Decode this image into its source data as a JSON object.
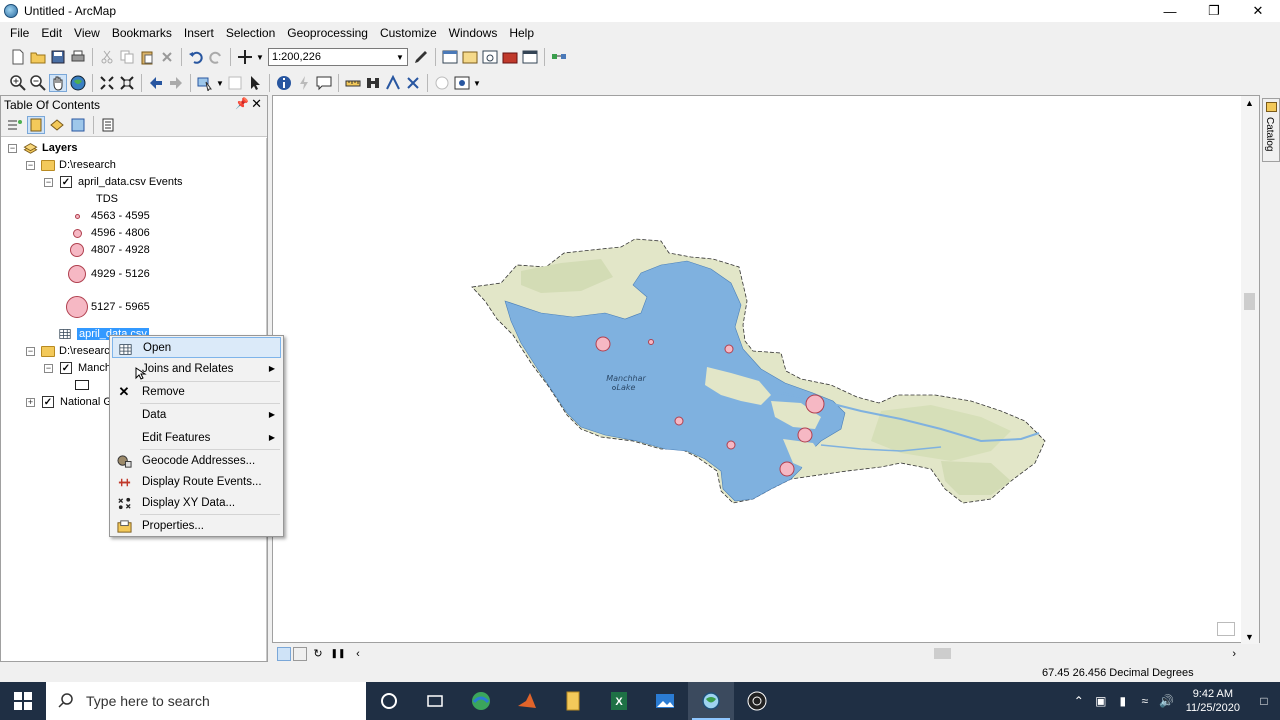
{
  "window": {
    "title": "Untitled - ArcMap"
  },
  "menu": [
    "File",
    "Edit",
    "View",
    "Bookmarks",
    "Insert",
    "Selection",
    "Geoprocessing",
    "Customize",
    "Windows",
    "Help"
  ],
  "toolbar": {
    "scale": "1:200,226"
  },
  "toc": {
    "title": "Table Of Contents",
    "root": "Layers",
    "group1": "D:\\research",
    "events_layer": "april_data.csv Events",
    "field": "TDS",
    "classes": [
      "4563 - 4595",
      "4596 - 4806",
      "4807 - 4928",
      "4929 - 5126",
      "5127 - 5965"
    ],
    "table": "april_data.csv",
    "group2": "D:\\research",
    "layer_manchhar": "Manchhar",
    "layer_basemap": "National Geographic"
  },
  "map": {
    "lake_label": "Manchhar Lake"
  },
  "context_menu": {
    "items": [
      {
        "label": "Open",
        "icon": "table-icon"
      },
      {
        "label": "Joins and Relates",
        "icon": "",
        "submenu": true
      },
      {
        "label": "Remove",
        "icon": "remove-icon"
      },
      {
        "label": "Data",
        "icon": "",
        "submenu": true
      },
      {
        "label": "Edit Features",
        "icon": "",
        "submenu": true
      },
      {
        "label": "Geocode Addresses...",
        "icon": "geocode-icon"
      },
      {
        "label": "Display Route Events...",
        "icon": "route-events-icon"
      },
      {
        "label": "Display XY Data...",
        "icon": "xy-data-icon"
      },
      {
        "label": "Properties...",
        "icon": "properties-icon"
      }
    ]
  },
  "catalog_tab": "Catalog",
  "status": {
    "coordinates": "67.45  26.456 Decimal Degrees"
  },
  "taskbar": {
    "search_placeholder": "Type here to search",
    "time": "9:42 AM",
    "date": "11/25/2020"
  },
  "colors": {
    "lake": "#7fb1df",
    "land": "#dfe4c4",
    "symbol_fill": "#f6b8c4",
    "selection": "#3399ff",
    "taskbar": "#1f2f44"
  }
}
